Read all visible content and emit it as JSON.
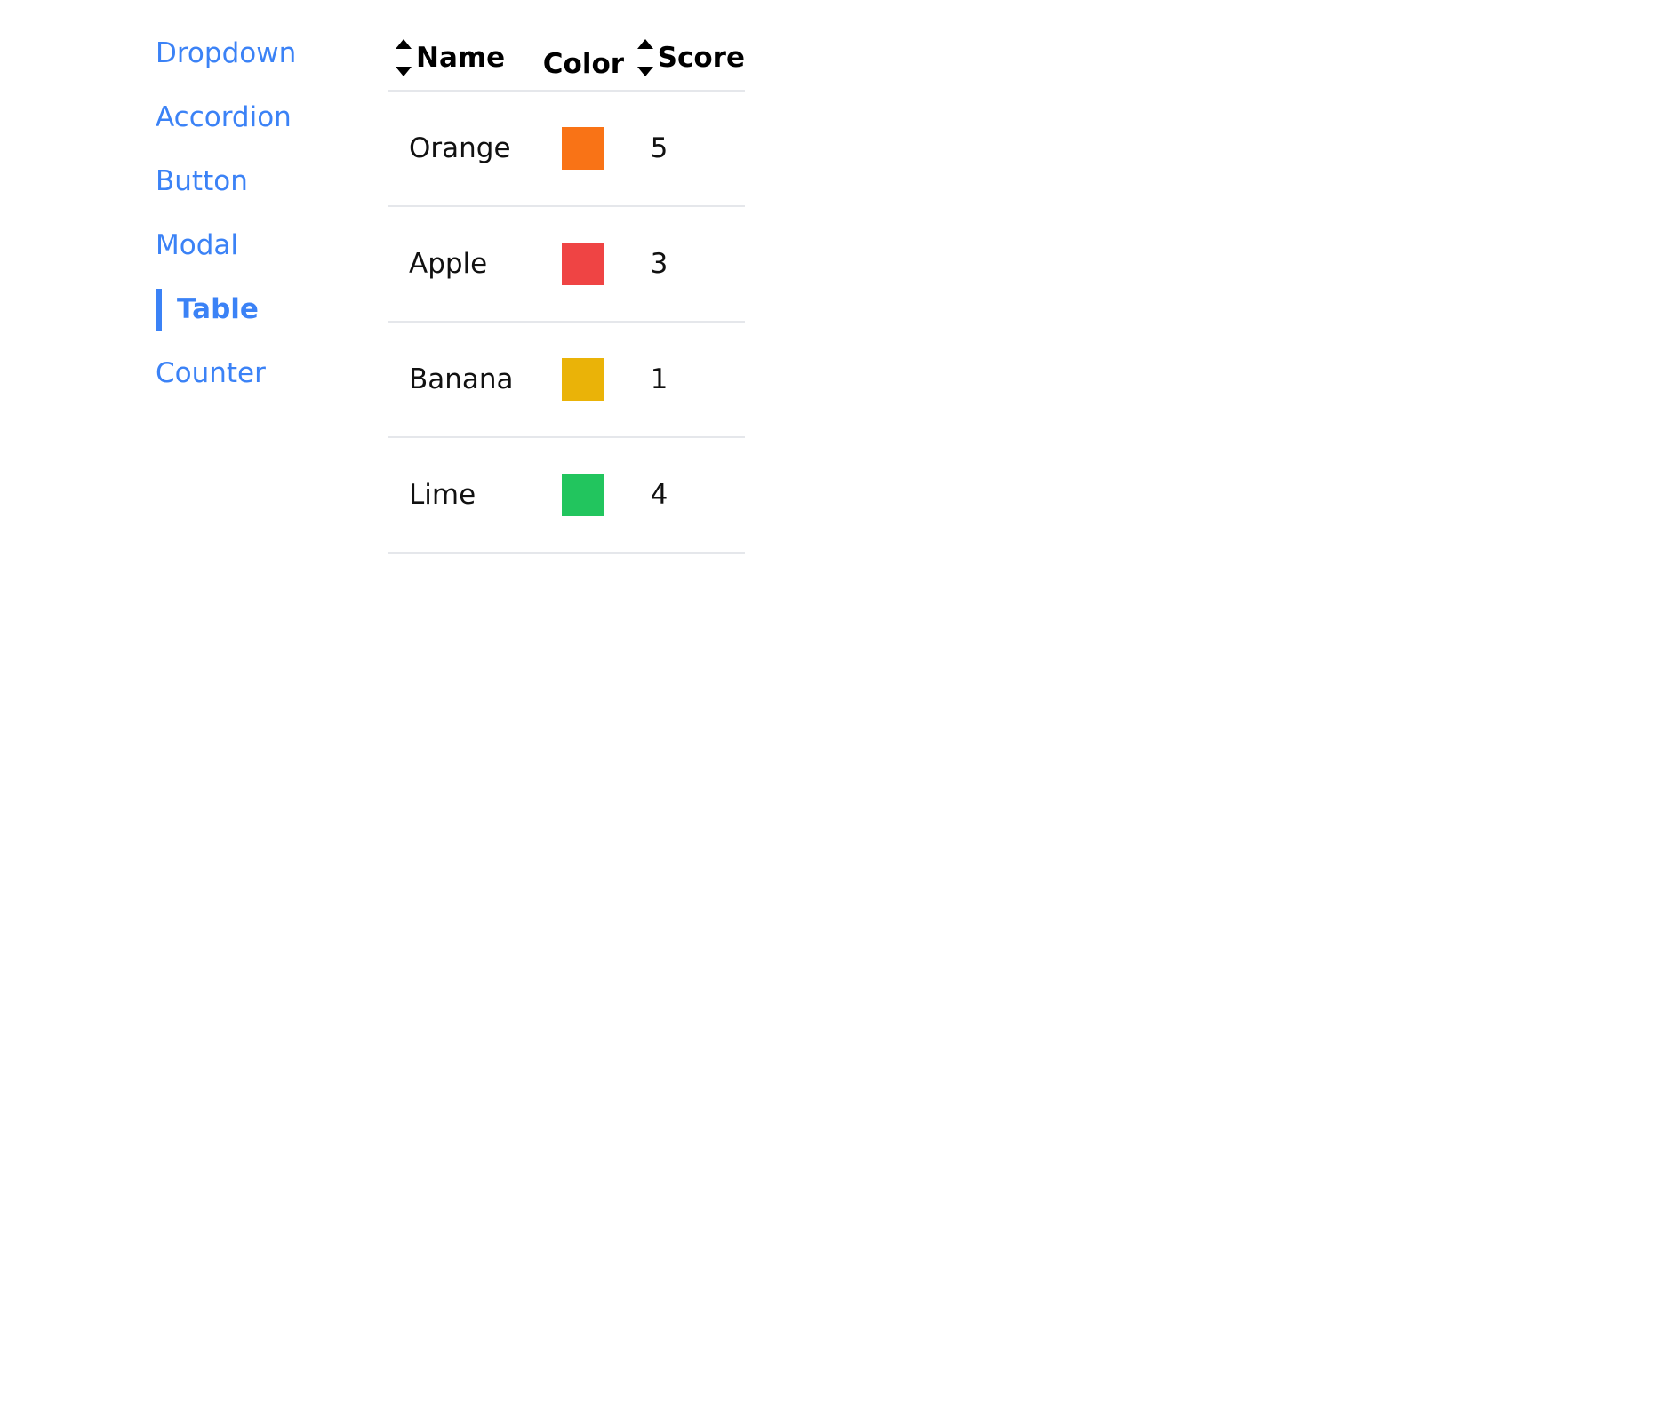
{
  "sidebar": {
    "items": [
      {
        "label": "Dropdown",
        "active": false
      },
      {
        "label": "Accordion",
        "active": false
      },
      {
        "label": "Button",
        "active": false
      },
      {
        "label": "Modal",
        "active": false
      },
      {
        "label": "Table",
        "active": true
      },
      {
        "label": "Counter",
        "active": false
      }
    ]
  },
  "table": {
    "columns": {
      "name": {
        "label": "Name",
        "sort_icon": "sort-updown-icon"
      },
      "color": {
        "label": "Color"
      },
      "score": {
        "label": "Score",
        "sort_icon": "sort-updown-icon"
      }
    },
    "rows": [
      {
        "name": "Orange",
        "color": "#f97316",
        "score": "5"
      },
      {
        "name": "Apple",
        "color": "#ef4444",
        "score": "3"
      },
      {
        "name": "Banana",
        "color": "#eab308",
        "score": "1"
      },
      {
        "name": "Lime",
        "color": "#22c55e",
        "score": "4"
      }
    ]
  },
  "theme": {
    "accent": "#3b82f6",
    "divider": "#e5e7eb"
  }
}
